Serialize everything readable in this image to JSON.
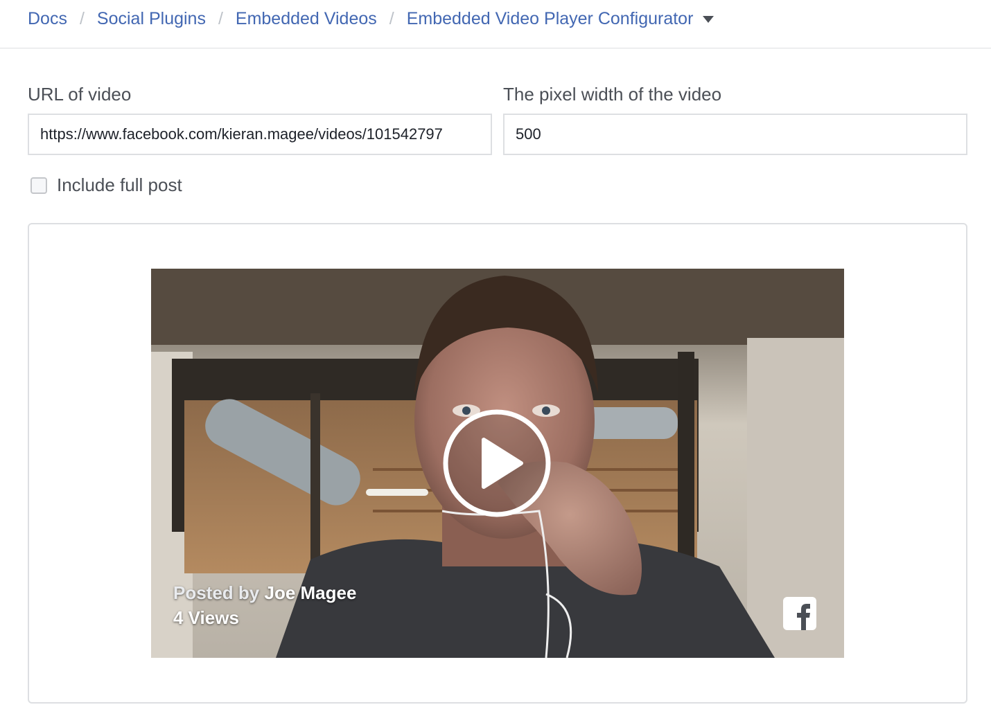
{
  "breadcrumb": {
    "items": [
      "Docs",
      "Social Plugins",
      "Embedded Videos",
      "Embedded Video Player Configurator"
    ],
    "separator": "/"
  },
  "form": {
    "url_label": "URL of video",
    "url_value": "https://www.facebook.com/kieran.magee/videos/101542797",
    "width_label": "The pixel width of the video",
    "width_value": "500",
    "include_full_post_label": "Include full post",
    "include_full_post_checked": false
  },
  "video": {
    "posted_by_prefix": "Posted by",
    "author": "Joe Magee",
    "views": "4 Views",
    "play_icon": "play-icon",
    "brand_icon": "facebook-icon"
  },
  "colors": {
    "link": "#4267b2",
    "border": "#dddfe2",
    "label": "#4b4f56"
  }
}
